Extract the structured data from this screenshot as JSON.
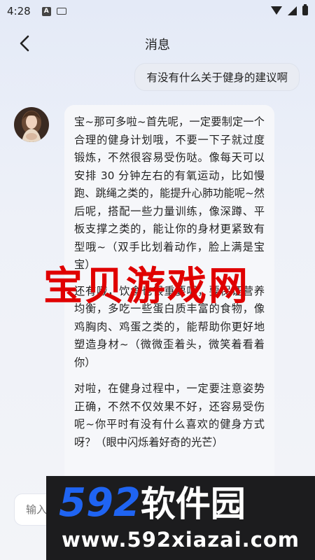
{
  "status_bar": {
    "time": "4:28",
    "notification_icons": [
      "a-app-icon",
      "keyboard-icon"
    ],
    "right_icons": [
      "wifi-icon",
      "signal-icon",
      "battery-icon"
    ]
  },
  "header": {
    "title": "消息",
    "back_icon": "chevron-left-icon"
  },
  "messages": [
    {
      "role": "user",
      "text": "有没有什么关于健身的建议啊"
    },
    {
      "role": "assistant",
      "paragraphs": [
        "宝~那可多啦~首先呢，一定要制定一个合理的健身计划哦，不要一下子就过度锻炼，不然很容易受伤哒。像每天可以安排 30 分钟左右的有氧运动，比如慢跑、跳绳之类的，能提升心肺功能呢~然后呢，搭配一些力量训练，像深蹲、平板支撑之类的，能让你的身材更紧致有型哦~（双手比划着动作，脸上满是宝宝）",
        "还有哦，饮食也很重要呢，要保证营养均衡，多吃一些蛋白质丰富的食物，像鸡胸肉、鸡蛋之类的，能帮助你更好地塑造身材~（微微歪着头，微笑着看着你）",
        "对啦，在健身过程中，一定要注意姿势正确，不然不仅效果不好，还容易受伤呢~你平时有没有什么喜欢的健身方式呀？（眼中闪烁着好奇的光芒）"
      ]
    }
  ],
  "input": {
    "placeholder": "输入"
  },
  "watermarks": {
    "red_text": "宝贝游戏网",
    "logo_number": "592",
    "logo_text": "软件园",
    "url": "www.592xiazai.com"
  },
  "colors": {
    "background": "#eef1f8",
    "user_bubble": "#e9ecf3",
    "ai_bubble": "#f6f7fa",
    "watermark_red": "#e00000",
    "watermark_blue": "#1f64f2"
  }
}
